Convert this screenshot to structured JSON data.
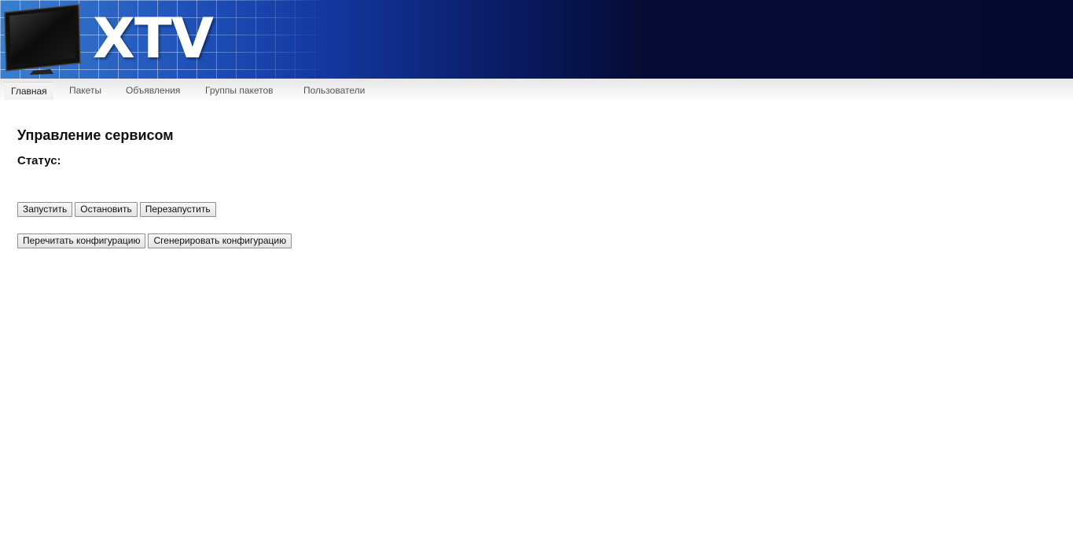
{
  "header": {
    "logo_text": "XTV"
  },
  "nav": {
    "items": [
      {
        "label": "Главная",
        "active": true
      },
      {
        "label": "Пакеты",
        "active": false
      },
      {
        "label": "Объявления",
        "active": false
      },
      {
        "label": "Группы пакетов",
        "active": false
      },
      {
        "label": "Пользователи",
        "active": false
      }
    ]
  },
  "main": {
    "title": "Управление сервисом",
    "status_label": "Статус:",
    "service_buttons": {
      "start": "Запустить",
      "stop": "Остановить",
      "restart": "Перезапустить"
    },
    "config_buttons": {
      "reread": "Перечитать конфигурацию",
      "generate": "Сгенерировать конфигурацию"
    }
  },
  "colors": {
    "header_dark": "#050930",
    "header_blue": "#1e50b8",
    "nav_bg": "#f3f3f3",
    "text": "#111111"
  }
}
